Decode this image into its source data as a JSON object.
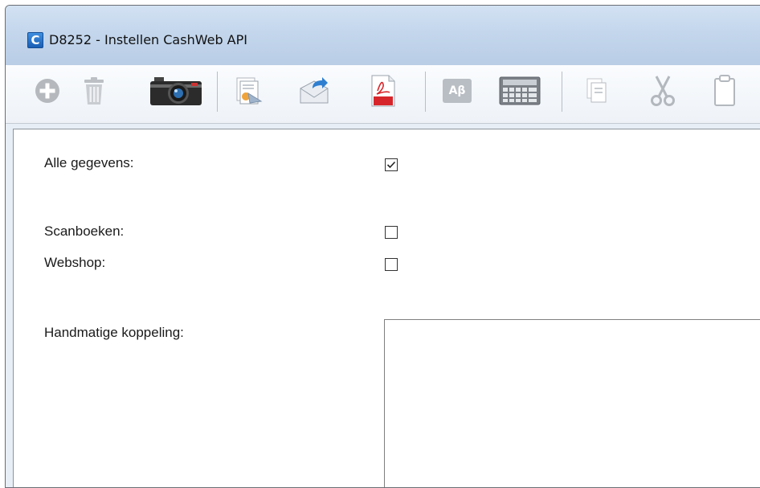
{
  "window": {
    "app_icon_letter": "C",
    "title": "D8252 - Instellen CashWeb API"
  },
  "toolbar": {
    "buttons": [
      {
        "name": "add-icon",
        "enabled": false
      },
      {
        "name": "delete-icon",
        "enabled": false
      },
      {
        "name": "camera-icon",
        "enabled": true
      },
      {
        "name": "scan-document-icon",
        "enabled": true
      },
      {
        "name": "send-mail-icon",
        "enabled": true
      },
      {
        "name": "pdf-icon",
        "enabled": true,
        "badge": "PDF"
      },
      {
        "name": "spelling-icon",
        "enabled": false,
        "badge": "Aβ"
      },
      {
        "name": "calculator-icon",
        "enabled": true
      },
      {
        "name": "copy-icon",
        "enabled": false
      },
      {
        "name": "cut-icon",
        "enabled": false
      },
      {
        "name": "paste-icon",
        "enabled": false
      }
    ]
  },
  "form": {
    "alle_gegevens": {
      "label": "Alle gegevens:",
      "checked": true
    },
    "scanboeken": {
      "label": "Scanboeken:",
      "checked": false
    },
    "webshop": {
      "label": "Webshop:",
      "checked": false
    },
    "handmatige_koppeling": {
      "label": "Handmatige koppeling:",
      "value": ""
    }
  },
  "colors": {
    "title_bar": "#c3d6ec",
    "disabled_icon": "#b9bec4",
    "pdf_red": "#d7262b",
    "accent_blue": "#2f7fd1"
  }
}
